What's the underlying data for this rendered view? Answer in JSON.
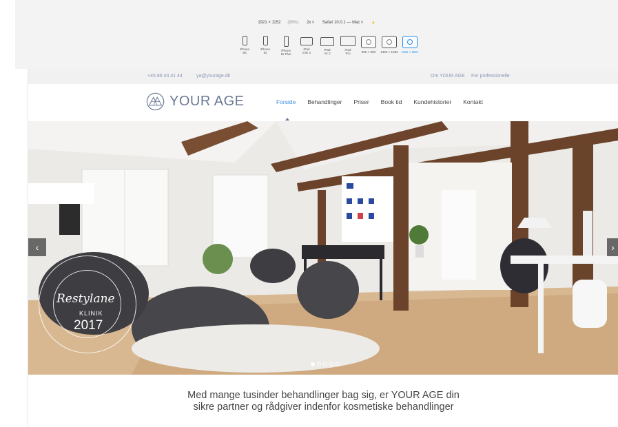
{
  "toolbar": {
    "resolution": "1921 × 1152",
    "percent": "(96%)",
    "scale": "2x ◊",
    "browser": "Safari 10.0.1 — Mac ◊",
    "warning_icon": "warning-icon"
  },
  "devices": [
    {
      "label1": "iPhone",
      "label2": "SE"
    },
    {
      "label1": "iPhone",
      "label2": "6s"
    },
    {
      "label1": "iPhone",
      "label2": "6s Plus"
    },
    {
      "label1": "iPad",
      "label2": "mini 4"
    },
    {
      "label1": "iPad",
      "label2": "Air 2"
    },
    {
      "label1": "iPad",
      "label2": "Pro"
    },
    {
      "label1": "800 × 600",
      "label2": ""
    },
    {
      "label1": "1366 × 1992",
      "label2": ""
    },
    {
      "label1": "1152 × 1921",
      "label2": ""
    }
  ],
  "topbar": {
    "phone": "+45 86 44 41 44",
    "email": "ya@yourage.dk",
    "link1": "Om YOUR AGE",
    "link2": "For professionelle"
  },
  "header": {
    "brand": "YOUR AGE"
  },
  "nav": [
    {
      "label": "Forside"
    },
    {
      "label": "Behandlinger"
    },
    {
      "label": "Priser"
    },
    {
      "label": "Book tid"
    },
    {
      "label": "Kundehistorier"
    },
    {
      "label": "Kontakt"
    }
  ],
  "badge": {
    "script": "Restylane",
    "klinik": "KLINIK",
    "year": "2017"
  },
  "slider": {
    "prev_icon": "chevron-left-icon",
    "next_icon": "chevron-right-icon",
    "active_slide": 1,
    "total_slides": 5
  },
  "tagline": {
    "line1": "Med mange tusinder behandlinger bag sig, er YOUR AGE din",
    "line2": "sikre partner og rådgiver indenfor kosmetiske behandlinger"
  },
  "colors": {
    "accent": "#3d8fdf",
    "brand": "#6a7895",
    "topbar_text": "#8a96b4"
  }
}
